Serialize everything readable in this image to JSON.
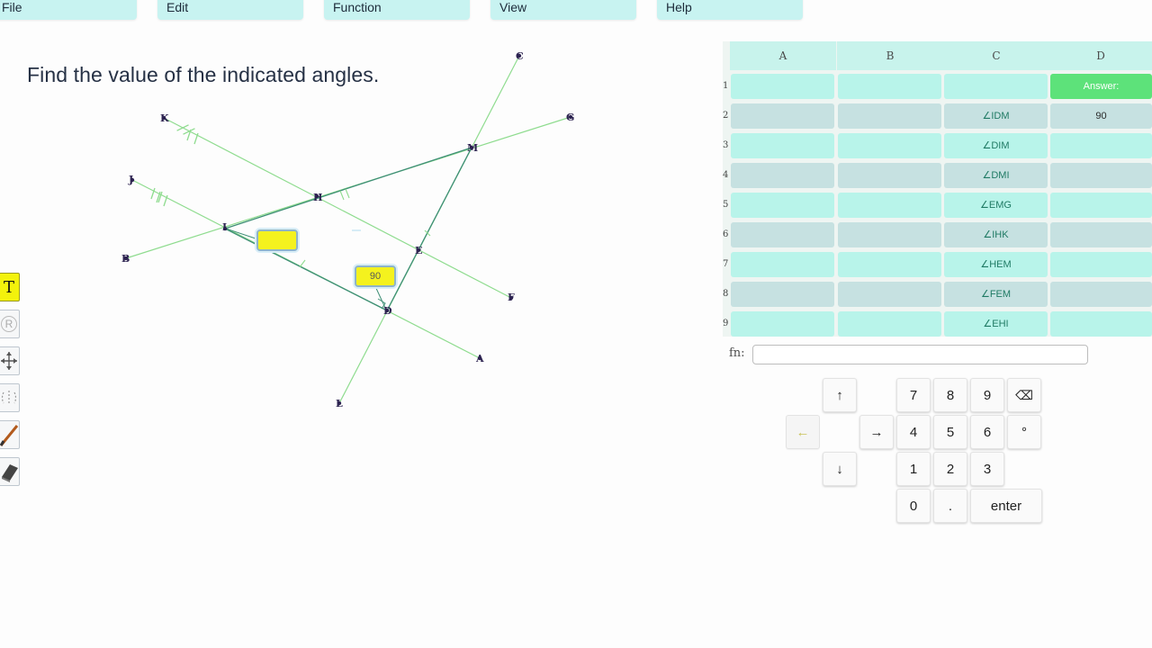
{
  "menu": {
    "file": "File",
    "edit": "Edit",
    "function": "Function",
    "view": "View",
    "help": "Help"
  },
  "prompt": "Find the value of the indicated angles.",
  "toolbar": {
    "text_tool": "T",
    "rotate_tool": "R",
    "icons": [
      "text-tool-icon",
      "rotate-icon",
      "move-arrows-icon",
      "reflect-icon",
      "pen-icon",
      "eraser-icon"
    ]
  },
  "figure": {
    "points": [
      "C",
      "G",
      "K",
      "M",
      "H",
      "J",
      "I",
      "B",
      "E",
      "F",
      "D",
      "A",
      "L"
    ],
    "answer_box_value": "",
    "label_box_value": "90"
  },
  "sheet": {
    "columns": [
      "A",
      "B",
      "C",
      "D"
    ],
    "rows": [
      {
        "num": "1",
        "c": "",
        "d": "Answer:"
      },
      {
        "num": "2",
        "c": "∠IDM",
        "d": "90"
      },
      {
        "num": "3",
        "c": "∠DIM",
        "d": ""
      },
      {
        "num": "4",
        "c": "∠DMI",
        "d": ""
      },
      {
        "num": "5",
        "c": "∠EMG",
        "d": ""
      },
      {
        "num": "6",
        "c": "∠IHK",
        "d": ""
      },
      {
        "num": "7",
        "c": "∠HEM",
        "d": ""
      },
      {
        "num": "8",
        "c": "∠FEM",
        "d": ""
      },
      {
        "num": "9",
        "c": "∠EHI",
        "d": ""
      }
    ]
  },
  "fn_bar": {
    "label": "fn:",
    "value": ""
  },
  "keypad": {
    "up": "↑",
    "left": "←",
    "right": "→",
    "down": "↓",
    "k7": "7",
    "k8": "8",
    "k9": "9",
    "backspace": "⌫",
    "k4": "4",
    "k5": "5",
    "k6": "6",
    "degree": "°",
    "k1": "1",
    "k2": "2",
    "k3": "3",
    "k0": "0",
    "dot": ".",
    "enter": "enter"
  },
  "colors": {
    "menu_bg": "#c8f3f1",
    "line_green": "#8fdc8f",
    "line_dark": "#3f8f76",
    "cell_teal": "#b8f4ea",
    "cell_grey": "#c6e1e1",
    "answer_green": "#5de27a",
    "highlight_yellow": "#f4f21e"
  }
}
